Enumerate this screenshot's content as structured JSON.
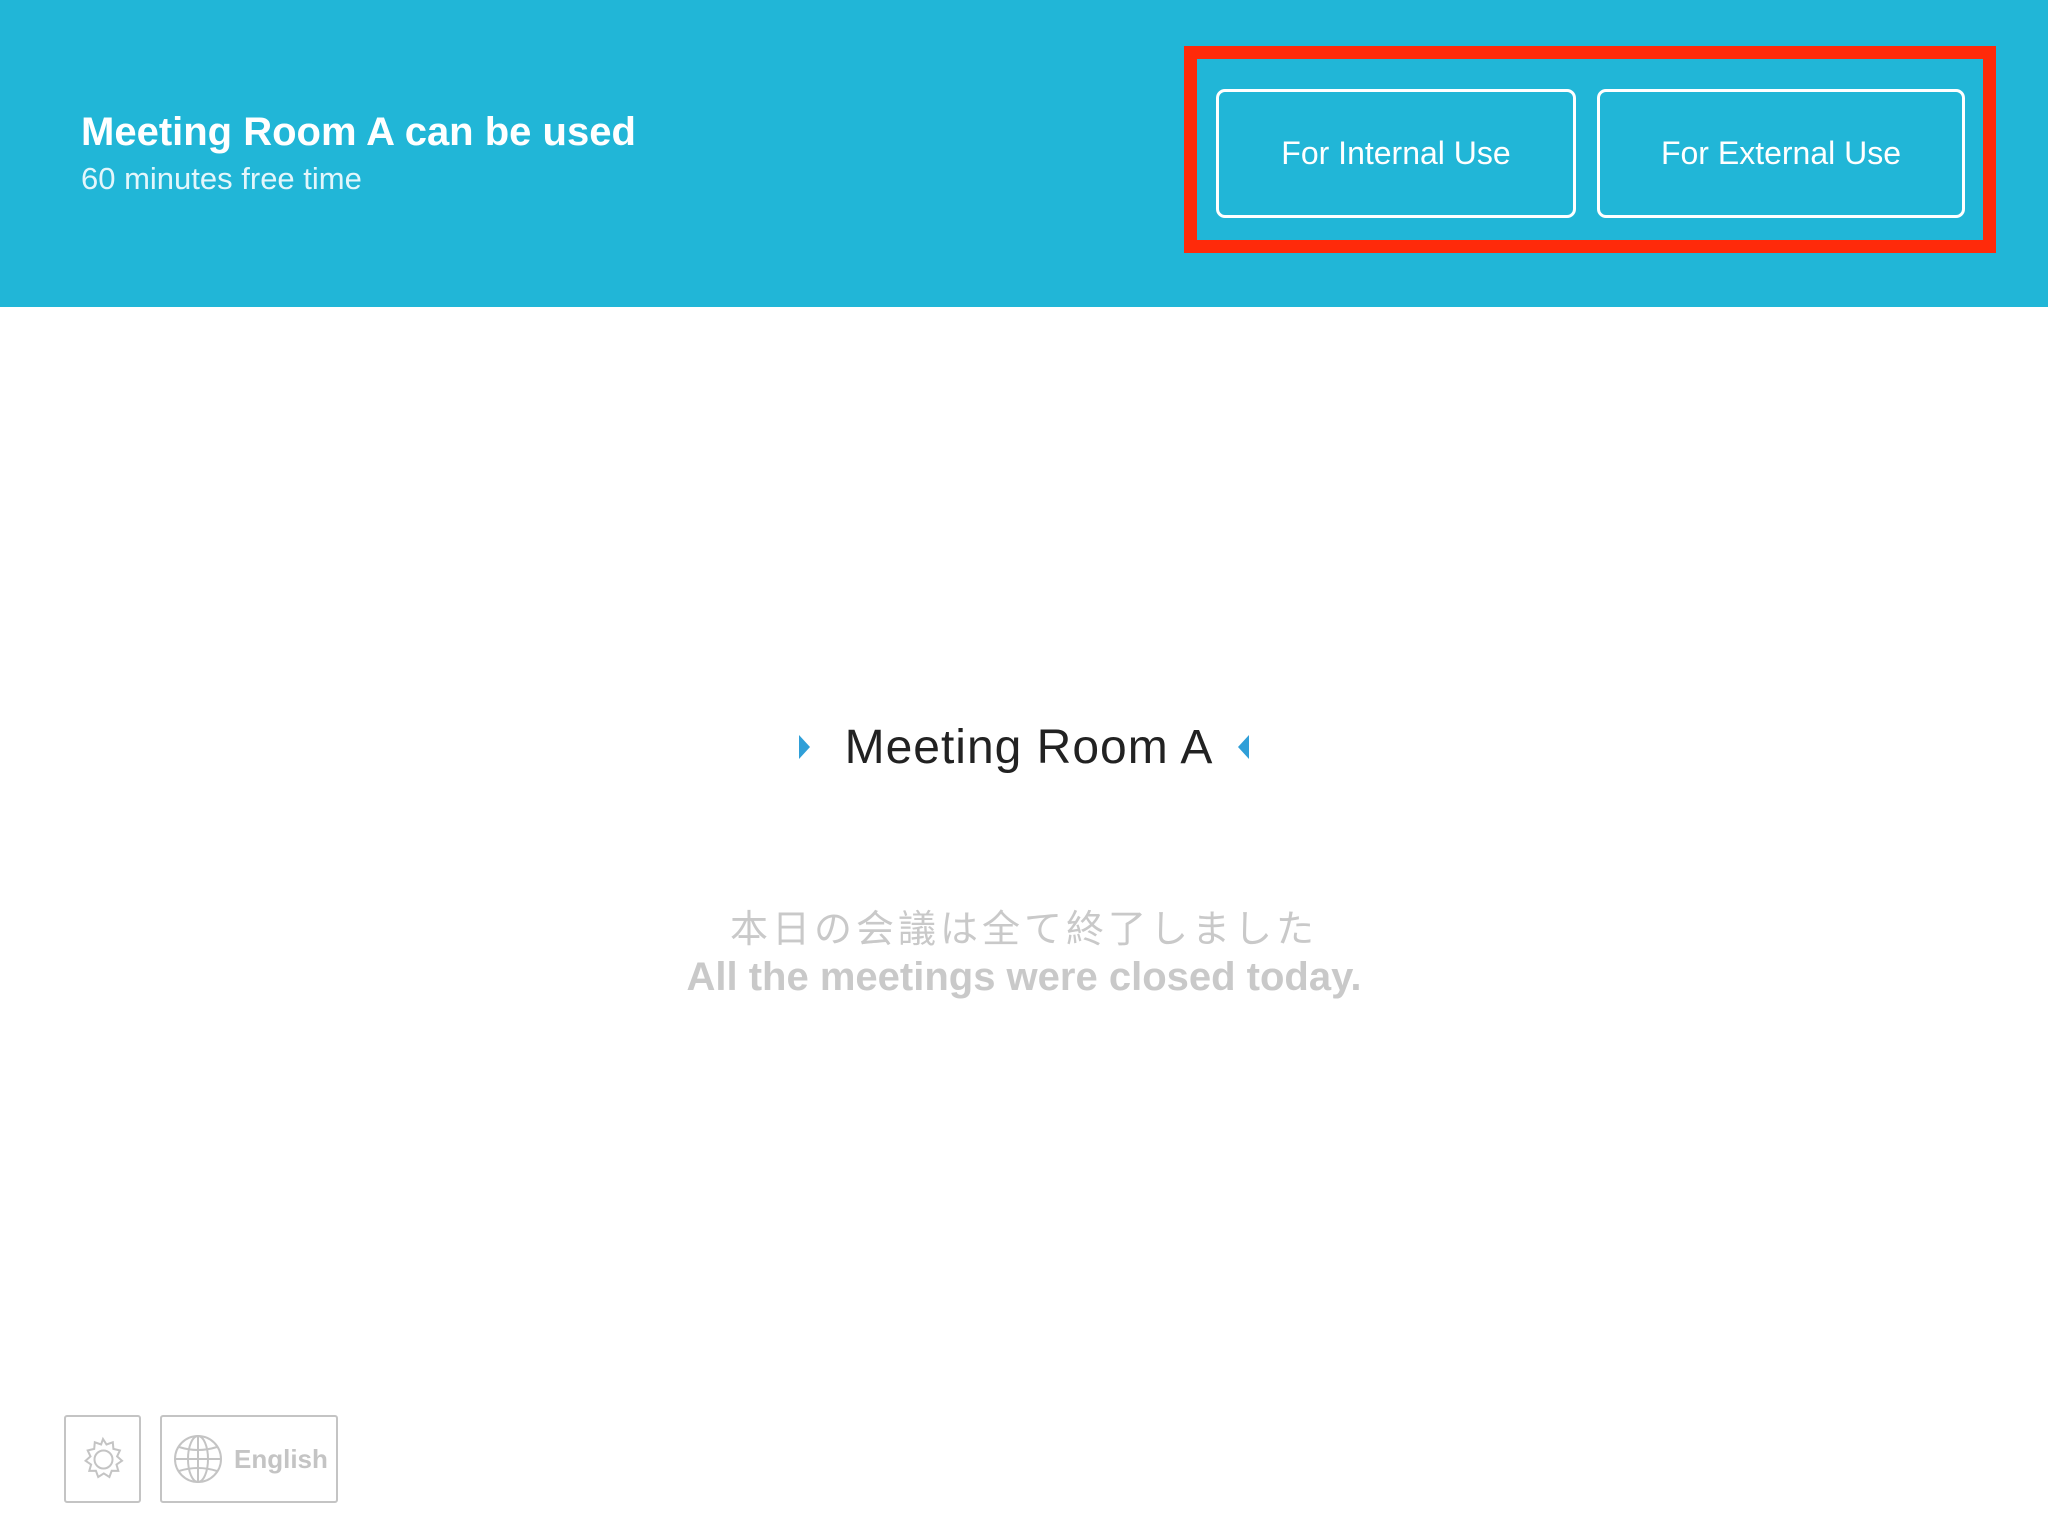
{
  "header": {
    "title": "Meeting Room A can be used",
    "subtitle": "60 minutes free time",
    "background_color": "#21b6d7",
    "buttons": {
      "internal_label": "For Internal Use",
      "external_label": "For External Use"
    },
    "highlight_color": "#ff2a0a"
  },
  "main": {
    "room_name": "Meeting Room A",
    "status_message_jp": "本日の会議は全て終了しました",
    "status_message_en": "All the meetings were closed today.",
    "arrow_color": "#2f9fd8"
  },
  "footer": {
    "settings_icon": "gear-icon",
    "language_icon": "globe-icon",
    "language_label": "English"
  }
}
